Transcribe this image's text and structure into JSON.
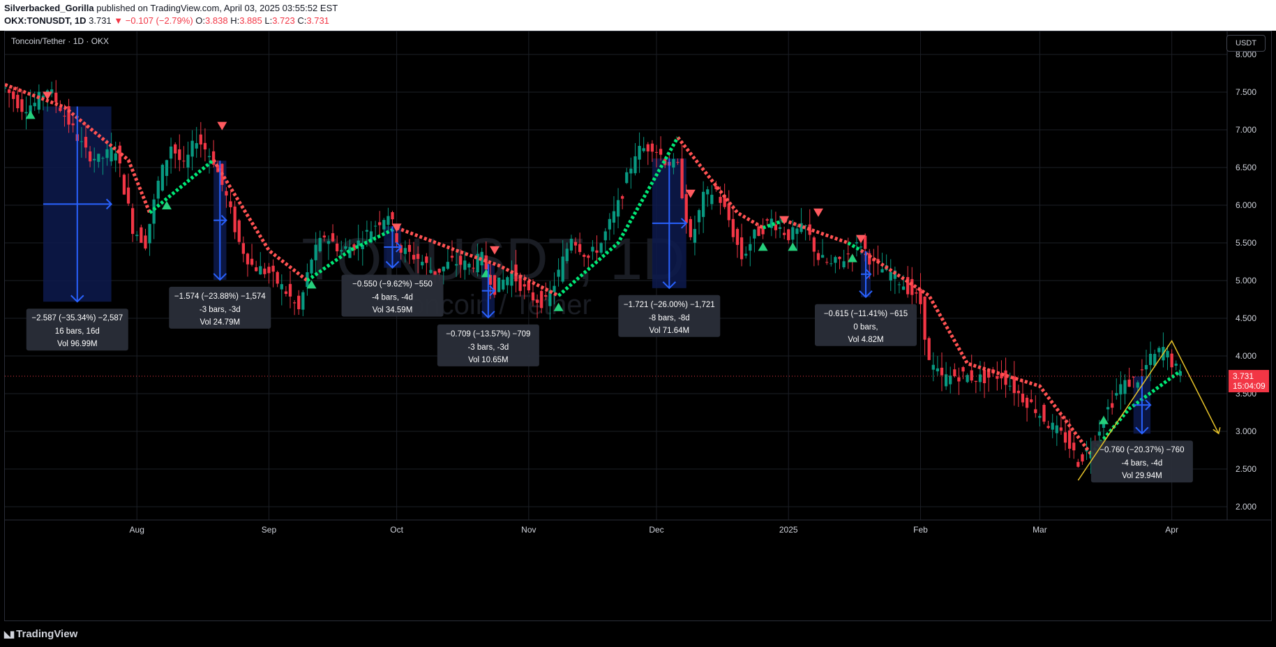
{
  "header": {
    "publisher": "Silverbacked_Gorilla",
    "published_text": "published on TradingView.com, April 03, 2025 03:55:52 EST",
    "symbol": "OKX:TONUSDT, 1D",
    "last": "3.731",
    "change": "−0.107 (−2.79%)",
    "open_label": "O:",
    "open": "3.838",
    "high_label": "H:",
    "high": "3.885",
    "low_label": "L:",
    "low": "3.723",
    "close_label": "C:",
    "close": "3.731"
  },
  "chart": {
    "pair_title": "Toncoin/Tether · 1D · OKX",
    "currency_button": "USDT",
    "watermark_symbol": "TONUSDT, 1D",
    "watermark_name": "Toncoin / Tether",
    "price_tag": "3.731",
    "countdown": "15:04:09"
  },
  "chart_data": {
    "type": "candlestick",
    "title": "Toncoin/Tether · 1D · OKX",
    "y_axis_ticks": [
      "8.000",
      "7.500",
      "7.000",
      "6.500",
      "6.000",
      "5.500",
      "5.000",
      "4.500",
      "4.000",
      "3.500",
      "3.000",
      "2.500",
      "2.000"
    ],
    "ylim": [
      2.0,
      8.0
    ],
    "x_axis_ticks": [
      "Aug",
      "Sep",
      "Oct",
      "Nov",
      "Dec",
      "2025",
      "Feb",
      "Mar",
      "Apr"
    ],
    "x_range": [
      "2024-07-01",
      "2025-04-14"
    ],
    "price_path": [
      [
        "2024-07-01",
        7.55
      ],
      [
        "2024-07-05",
        7.3
      ],
      [
        "2024-07-08",
        7.35
      ],
      [
        "2024-07-11",
        7.55
      ],
      [
        "2024-07-14",
        7.3
      ],
      [
        "2024-07-17",
        7.0
      ],
      [
        "2024-07-20",
        6.7
      ],
      [
        "2024-07-23",
        6.6
      ],
      [
        "2024-07-27",
        6.75
      ],
      [
        "2024-07-31",
        5.7
      ],
      [
        "2024-08-03",
        5.5
      ],
      [
        "2024-08-06",
        6.3
      ],
      [
        "2024-08-09",
        6.8
      ],
      [
        "2024-08-12",
        6.5
      ],
      [
        "2024-08-15",
        6.9
      ],
      [
        "2024-08-19",
        6.6
      ],
      [
        "2024-08-22",
        6.1
      ],
      [
        "2024-08-25",
        5.5
      ],
      [
        "2024-08-28",
        5.2
      ],
      [
        "2024-09-01",
        5.1
      ],
      [
        "2024-09-05",
        4.85
      ],
      [
        "2024-09-08",
        4.6
      ],
      [
        "2024-09-11",
        5.3
      ],
      [
        "2024-09-14",
        5.6
      ],
      [
        "2024-09-18",
        5.4
      ],
      [
        "2024-09-22",
        5.5
      ],
      [
        "2024-09-26",
        5.75
      ],
      [
        "2024-09-29",
        5.9
      ],
      [
        "2024-10-02",
        5.4
      ],
      [
        "2024-10-06",
        5.3
      ],
      [
        "2024-10-10",
        5.1
      ],
      [
        "2024-10-14",
        5.25
      ],
      [
        "2024-10-18",
        5.2
      ],
      [
        "2024-10-21",
        5.3
      ],
      [
        "2024-10-24",
        4.9
      ],
      [
        "2024-10-28",
        5.1
      ],
      [
        "2024-11-01",
        4.8
      ],
      [
        "2024-11-05",
        4.7
      ],
      [
        "2024-11-08",
        5.1
      ],
      [
        "2024-11-11",
        5.6
      ],
      [
        "2024-11-15",
        5.3
      ],
      [
        "2024-11-18",
        5.5
      ],
      [
        "2024-11-22",
        6.0
      ],
      [
        "2024-11-26",
        6.7
      ],
      [
        "2024-11-30",
        6.8
      ],
      [
        "2024-12-03",
        6.6
      ],
      [
        "2024-12-06",
        6.5
      ],
      [
        "2024-12-09",
        5.5
      ],
      [
        "2024-12-12",
        6.1
      ],
      [
        "2024-12-15",
        6.2
      ],
      [
        "2024-12-18",
        5.8
      ],
      [
        "2024-12-21",
        5.3
      ],
      [
        "2024-12-24",
        5.6
      ],
      [
        "2024-12-28",
        5.8
      ],
      [
        "2025-01-01",
        5.6
      ],
      [
        "2025-01-05",
        5.7
      ],
      [
        "2025-01-08",
        5.3
      ],
      [
        "2025-01-11",
        5.2
      ],
      [
        "2025-01-14",
        5.3
      ],
      [
        "2025-01-18",
        5.5
      ],
      [
        "2025-01-21",
        5.2
      ],
      [
        "2025-01-25",
        5.1
      ],
      [
        "2025-01-29",
        4.9
      ],
      [
        "2025-02-01",
        4.7
      ],
      [
        "2025-02-03",
        3.9
      ],
      [
        "2025-02-06",
        3.7
      ],
      [
        "2025-02-10",
        3.75
      ],
      [
        "2025-02-15",
        3.7
      ],
      [
        "2025-02-20",
        3.75
      ],
      [
        "2025-02-24",
        3.5
      ],
      [
        "2025-02-28",
        3.3
      ],
      [
        "2025-03-03",
        3.1
      ],
      [
        "2025-03-07",
        2.9
      ],
      [
        "2025-03-10",
        2.6
      ],
      [
        "2025-03-13",
        2.8
      ],
      [
        "2025-03-17",
        3.3
      ],
      [
        "2025-03-20",
        3.6
      ],
      [
        "2025-03-24",
        3.7
      ],
      [
        "2025-03-27",
        3.95
      ],
      [
        "2025-03-30",
        4.1
      ],
      [
        "2025-04-03",
        3.731
      ]
    ],
    "trend_line_red_segments": [
      [
        [
          "2024-07-01",
          7.6
        ],
        [
          "2024-07-15",
          7.3
        ],
        [
          "2024-07-30",
          6.6
        ],
        [
          "2024-08-04",
          5.9
        ]
      ],
      [
        [
          "2024-08-19",
          6.6
        ],
        [
          "2024-09-01",
          5.4
        ],
        [
          "2024-09-10",
          5.0
        ]
      ],
      [
        [
          "2024-10-01",
          5.7
        ],
        [
          "2024-10-15",
          5.4
        ],
        [
          "2024-10-25",
          5.2
        ],
        [
          "2024-11-08",
          4.8
        ]
      ],
      [
        [
          "2024-12-06",
          6.9
        ],
        [
          "2024-12-20",
          5.9
        ],
        [
          "2024-12-26",
          5.7
        ]
      ],
      [
        [
          "2024-12-31",
          5.8
        ],
        [
          "2025-01-15",
          5.5
        ]
      ],
      [
        [
          "2025-01-18",
          5.4
        ],
        [
          "2025-02-03",
          4.8
        ],
        [
          "2025-02-12",
          3.9
        ],
        [
          "2025-03-01",
          3.6
        ],
        [
          "2025-03-13",
          2.7
        ]
      ]
    ],
    "trend_line_green_segments": [
      [
        [
          "2024-08-04",
          5.9
        ],
        [
          "2024-08-19",
          6.6
        ]
      ],
      [
        [
          "2024-09-10",
          5.0
        ],
        [
          "2024-09-20",
          5.4
        ],
        [
          "2024-10-01",
          5.7
        ]
      ],
      [
        [
          "2024-11-08",
          4.8
        ],
        [
          "2024-11-22",
          5.5
        ],
        [
          "2024-12-06",
          6.9
        ]
      ],
      [
        [
          "2024-12-26",
          5.7
        ],
        [
          "2024-12-31",
          5.8
        ]
      ],
      [
        [
          "2025-01-15",
          5.5
        ],
        [
          "2025-01-18",
          5.4
        ]
      ],
      [
        [
          "2025-03-13",
          2.7
        ],
        [
          "2025-03-22",
          3.3
        ],
        [
          "2025-04-03",
          3.8
        ]
      ]
    ],
    "sell_signals": [
      [
        "2024-07-11",
        7.45
      ],
      [
        "2024-08-21",
        7.05
      ],
      [
        "2024-10-01",
        5.7
      ],
      [
        "2024-10-24",
        5.4
      ],
      [
        "2024-12-09",
        6.15
      ],
      [
        "2024-12-31",
        5.8
      ],
      [
        "2025-01-08",
        5.9
      ],
      [
        "2025-01-18",
        5.55
      ]
    ],
    "buy_signals": [
      [
        "2024-07-07",
        7.2
      ],
      [
        "2024-08-08",
        6.0
      ],
      [
        "2024-09-11",
        4.95
      ],
      [
        "2024-10-22",
        5.1
      ],
      [
        "2024-11-08",
        4.65
      ],
      [
        "2024-12-26",
        5.45
      ],
      [
        "2025-01-02",
        5.45
      ],
      [
        "2025-01-16",
        5.3
      ],
      [
        "2025-03-16",
        3.15
      ]
    ],
    "measurements": [
      {
        "x1": "2024-07-10",
        "x2": "2024-07-26",
        "from": 7.31,
        "to": 4.72,
        "label1": "−2.587 (−35.34%) −2,587",
        "label2": "16 bars, 16d",
        "label3": "Vol 96.99M"
      },
      {
        "x1": "2024-08-19",
        "x2": "2024-08-22",
        "from": 6.59,
        "to": 5.01,
        "label1": "−1.574 (−23.88%) −1,574",
        "label2": "-3 bars, -3d",
        "label3": "Vol 24.79M"
      },
      {
        "x1": "2024-09-28",
        "x2": "2024-10-02",
        "from": 5.72,
        "to": 5.17,
        "label1": "−0.550 (−9.62%) −550",
        "label2": "-4 bars, -4d",
        "label3": "Vol 34.59M"
      },
      {
        "x1": "2024-10-21",
        "x2": "2024-10-24",
        "from": 5.22,
        "to": 4.51,
        "label1": "−0.709 (−13.57%) −709",
        "label2": "-3 bars, -3d",
        "label3": "Vol 10.65M"
      },
      {
        "x1": "2024-11-30",
        "x2": "2024-12-08",
        "from": 6.62,
        "to": 4.9,
        "label1": "−1.721 (−26.00%) −1,721",
        "label2": "-8 bars, -8d",
        "label3": "Vol 71.64M"
      },
      {
        "x1": "2025-01-18",
        "x2": "2025-01-18",
        "from": 5.39,
        "to": 4.78,
        "label1": "−0.615 (−11.41%) −615",
        "label2": "0 bars,",
        "label3": "Vol 4.82M"
      },
      {
        "x1": "2025-03-23",
        "x2": "2025-03-27",
        "from": 3.73,
        "to": 2.97,
        "label1": "−0.760 (−20.37%) −760",
        "label2": "-4 bars, -4d",
        "label3": "Vol 29.94M"
      }
    ],
    "projection_line": [
      [
        "2025-03-10",
        2.35
      ],
      [
        "2025-04-01",
        4.2
      ],
      [
        "2025-04-12",
        2.97
      ]
    ],
    "current_price": 3.731
  },
  "footer": {
    "logo_text": "TradingView"
  },
  "colors": {
    "up": "#089981",
    "down": "#f23645",
    "trend_green": "#00e676",
    "trend_red": "#ff5252",
    "arrow_up": "#26d07c",
    "arrow_down": "#ff5a5f",
    "measure": "#2962ff",
    "measure_fill": "#0d1a4d",
    "projection": "#e6c229",
    "grid": "#1c1f26"
  }
}
